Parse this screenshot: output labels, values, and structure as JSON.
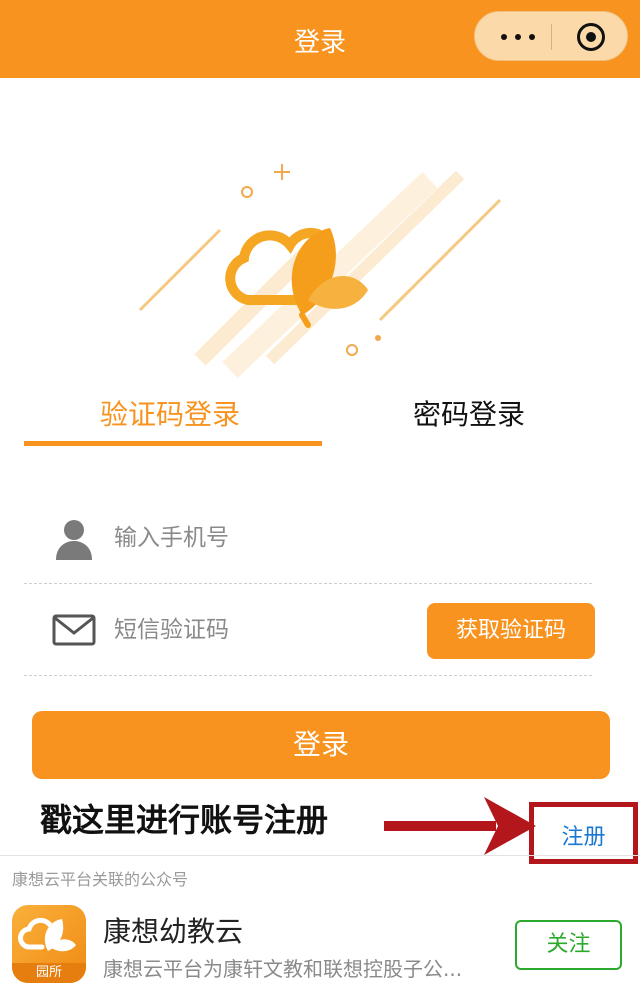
{
  "nav": {
    "title": "登录",
    "background": "#F7931E",
    "more_icon": "more-dots-icon",
    "close_icon": "target-icon"
  },
  "tabs": [
    {
      "label": "验证码登录",
      "active": true
    },
    {
      "label": "密码登录",
      "active": false
    }
  ],
  "form": {
    "phone": {
      "icon": "user-icon",
      "placeholder": "输入手机号",
      "value": ""
    },
    "code": {
      "icon": "mail-icon",
      "placeholder": "短信验证码",
      "value": ""
    },
    "get_code_label": "获取验证码",
    "login_label": "登录"
  },
  "annotation": {
    "text": "戳这里进行账号注册",
    "arrow_color": "#B3171B",
    "register_label": "注册",
    "register_color": "#1A77D2"
  },
  "official_account": {
    "header": "康想云平台关联的公众号",
    "name": "康想幼教云",
    "description": "康想云平台为康轩文教和联想控股子公...",
    "badge": "园所",
    "follow_label": "关注",
    "follow_color": "#2DAA2E"
  },
  "colors": {
    "accent": "#F7931E"
  }
}
